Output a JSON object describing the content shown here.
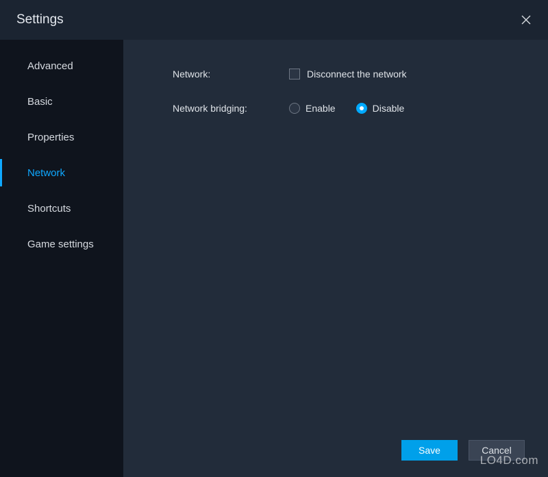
{
  "titlebar": {
    "title": "Settings"
  },
  "sidebar": {
    "items": [
      {
        "label": "Advanced",
        "active": false
      },
      {
        "label": "Basic",
        "active": false
      },
      {
        "label": "Properties",
        "active": false
      },
      {
        "label": "Network",
        "active": true
      },
      {
        "label": "Shortcuts",
        "active": false
      },
      {
        "label": "Game settings",
        "active": false
      }
    ]
  },
  "content": {
    "network": {
      "label": "Network:",
      "checkbox_label": "Disconnect the network",
      "checked": false
    },
    "bridging": {
      "label": "Network bridging:",
      "options": [
        {
          "label": "Enable",
          "selected": false
        },
        {
          "label": "Disable",
          "selected": true
        }
      ]
    }
  },
  "footer": {
    "save": "Save",
    "cancel": "Cancel"
  },
  "watermark": "LO4D.com"
}
